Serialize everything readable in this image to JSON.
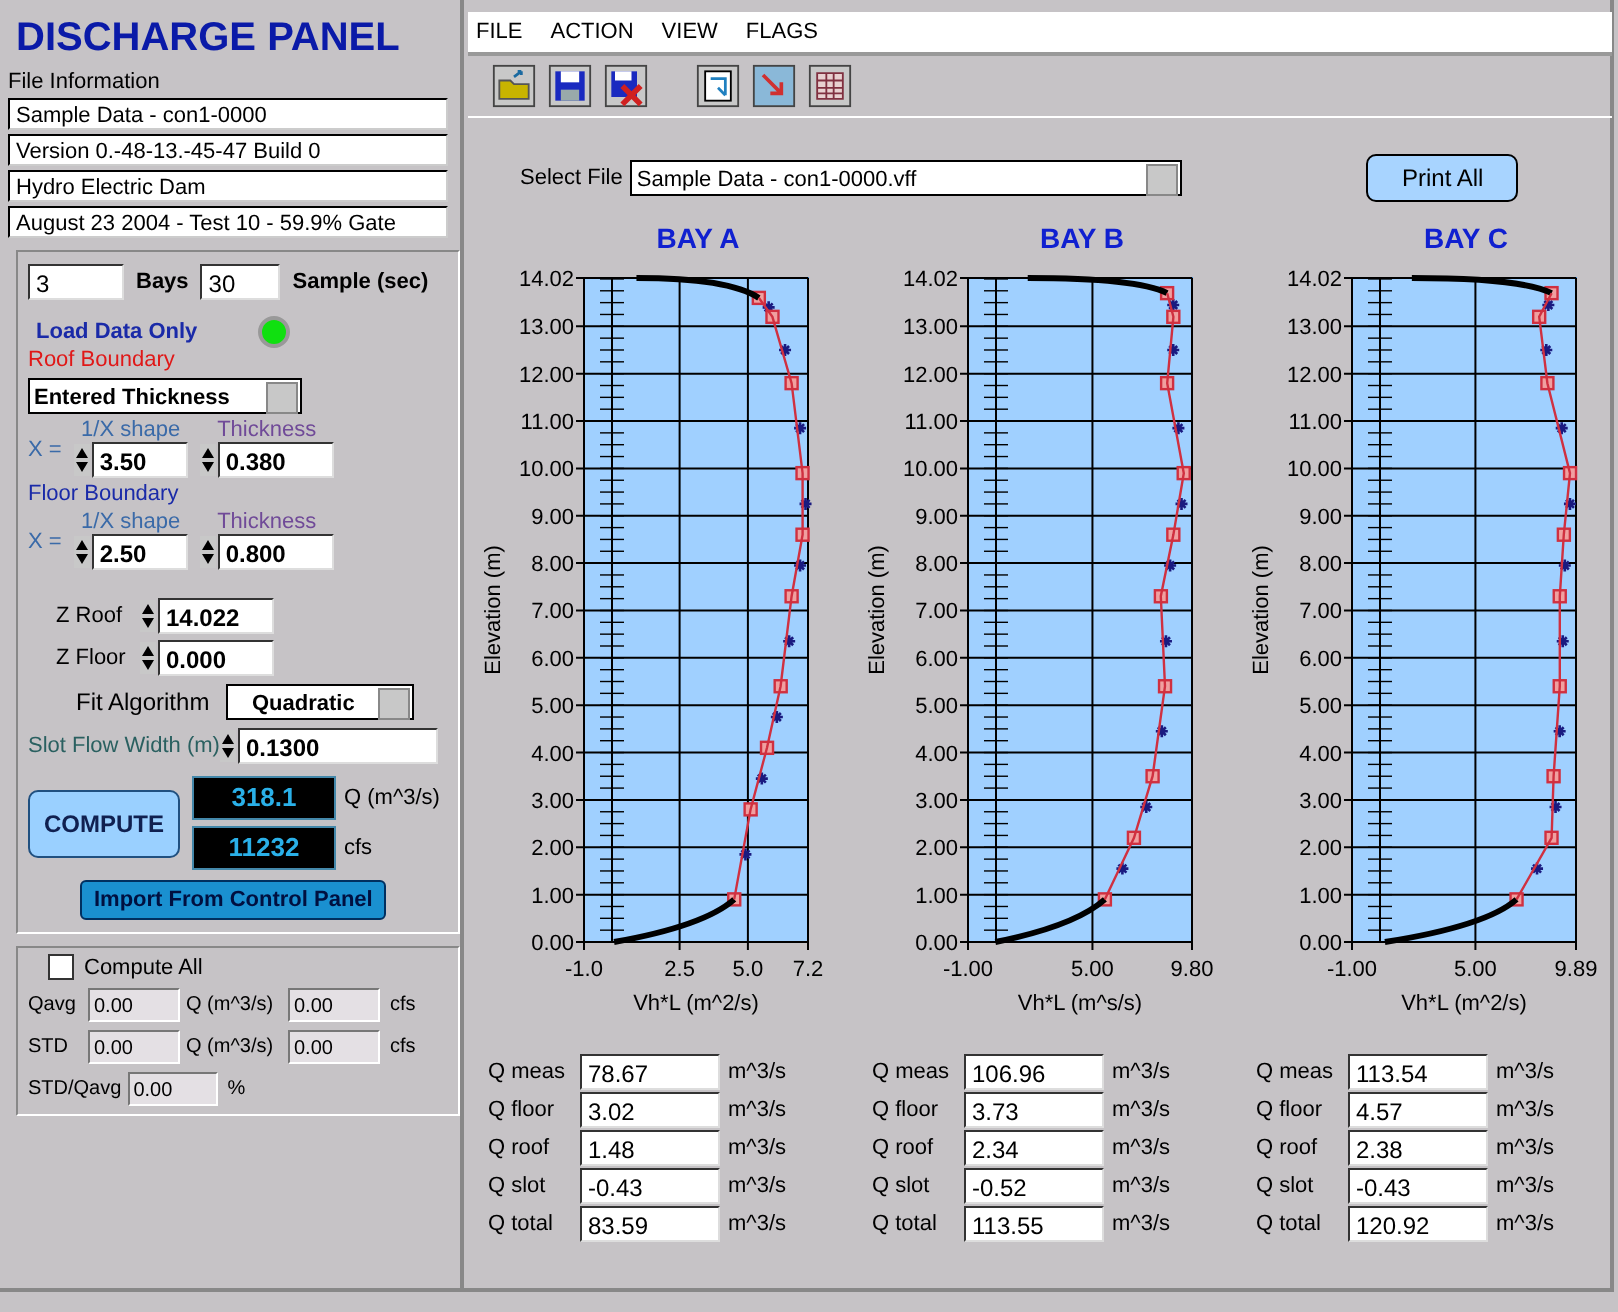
{
  "title": "DISCHARGE PANEL",
  "file_information": {
    "label": "File Information",
    "lines": [
      "Sample Data - con1-0000",
      "Version 0.-48-13.-45-47 Build 0",
      "Hydro Electric Dam",
      "August 23 2004 - Test 10 - 59.9% Gate"
    ]
  },
  "settings": {
    "bays": {
      "value": "3",
      "label": "Bays"
    },
    "sample": {
      "value": "30",
      "label": "Sample (sec)"
    },
    "load_data_only": {
      "label": "Load Data Only",
      "on": true
    },
    "roof_boundary": {
      "label": "Roof Boundary",
      "mode": "Entered Thickness",
      "x_label": "X =",
      "shape_label": "1/X shape",
      "shape": "3.50",
      "thickness_label": "Thickness",
      "thickness": "0.380"
    },
    "floor_boundary": {
      "label": "Floor Boundary",
      "x_label": "X =",
      "shape_label": "1/X shape",
      "shape": "2.50",
      "thickness_label": "Thickness",
      "thickness": "0.800"
    },
    "z_roof": {
      "label": "Z Roof",
      "value": "14.022"
    },
    "z_floor": {
      "label": "Z Floor",
      "value": "0.000"
    },
    "fit_algorithm": {
      "label": "Fit Algorithm",
      "value": "Quadratic"
    },
    "slot_flow_width": {
      "label": "Slot Flow Width (m)",
      "value": "0.1300"
    },
    "compute_button": "COMPUTE",
    "q_display": {
      "value": "318.1",
      "unit": "Q (m^3/s)"
    },
    "cfs_display": {
      "value": "11232",
      "unit": "cfs"
    },
    "import_button": "Import From Control Panel"
  },
  "summary": {
    "compute_all": {
      "label": "Compute All",
      "checked": false
    },
    "rows": [
      {
        "label": "Qavg",
        "q": "0.00",
        "q_unit": "Q (m^3/s)",
        "cfs": "0.00",
        "cfs_unit": "cfs"
      },
      {
        "label": "STD",
        "q": "0.00",
        "q_unit": "Q (m^3/s)",
        "cfs": "0.00",
        "cfs_unit": "cfs"
      }
    ],
    "ratio": {
      "label": "STD/Qavg",
      "value": "0.00",
      "unit": "%"
    }
  },
  "menu": [
    "FILE",
    "ACTION",
    "VIEW",
    "FLAGS"
  ],
  "toolbar": [
    {
      "kind": "open"
    },
    {
      "kind": "save"
    },
    {
      "kind": "delete"
    },
    {
      "kind": "copy"
    },
    {
      "kind": "export"
    },
    {
      "kind": "table"
    }
  ],
  "select_file": {
    "label": "Select File",
    "value": "Sample Data - con1-0000.vff"
  },
  "print_button": "Print All",
  "bays": [
    {
      "chart_data": {
        "type": "scatter",
        "title": "BAY A",
        "grid": true,
        "xlabel": "Vh*L (m^2/s)",
        "ylabel": "Elevation (m)",
        "x": [
          4.5,
          5.1,
          5.7,
          6.2,
          6.6,
          7.0,
          7.0,
          6.6,
          5.9,
          5.4
        ],
        "xlim": [
          -1.0,
          7.2
        ],
        "ylim": [
          0,
          14.02
        ],
        "xticks": [
          {
            "value": -1.0,
            "label": "-1.0"
          },
          {
            "value": 2.5,
            "label": "2.5"
          },
          {
            "value": 5.0,
            "label": "5.0"
          },
          {
            "value": 7.2,
            "label": "7.2"
          }
        ],
        "yticks": [
          {
            "value": 0,
            "label": "0.00"
          },
          {
            "value": 1,
            "label": "1.00"
          },
          {
            "value": 2,
            "label": "2.00"
          },
          {
            "value": 3,
            "label": "3.00"
          },
          {
            "value": 4,
            "label": "4.00"
          },
          {
            "value": 5,
            "label": "5.00"
          },
          {
            "value": 6,
            "label": "6.00"
          },
          {
            "value": 7,
            "label": "7.00"
          },
          {
            "value": 8,
            "label": "8.00"
          },
          {
            "value": 9,
            "label": "9.00"
          },
          {
            "value": 10,
            "label": "10.00"
          },
          {
            "value": 11,
            "label": "11.00"
          },
          {
            "value": 12,
            "label": "12.00"
          },
          {
            "value": 13,
            "label": "13.00"
          },
          {
            "value": 14.02,
            "label": "14.02"
          }
        ],
        "series": [
          {
            "color": "#d03040",
            "values": [
              0.9,
              2.8,
              4.1,
              5.4,
              7.3,
              8.6,
              9.9,
              11.8,
              13.2,
              13.6
            ]
          }
        ]
      },
      "results": [
        {
          "label": "Q meas",
          "value": "78.67",
          "unit": "m^3/s"
        },
        {
          "label": "Q floor",
          "value": "3.02",
          "unit": "m^3/s"
        },
        {
          "label": "Q roof",
          "value": "1.48",
          "unit": "m^3/s"
        },
        {
          "label": "Q slot",
          "value": "-0.43",
          "unit": "m^3/s"
        },
        {
          "label": "Q total",
          "value": "83.59",
          "unit": "m^3/s"
        }
      ]
    },
    {
      "chart_data": {
        "type": "scatter",
        "title": "BAY B",
        "grid": true,
        "xlabel": "Vh*L (m^s/s)",
        "ylabel": "Elevation (m)",
        "x": [
          5.6,
          7.0,
          7.9,
          8.5,
          8.3,
          8.9,
          9.4,
          8.6,
          8.9,
          8.6
        ],
        "xlim": [
          -1.0,
          9.8
        ],
        "ylim": [
          0,
          14.02
        ],
        "xticks": [
          {
            "value": -1.0,
            "label": "-1.00"
          },
          {
            "value": 5.0,
            "label": "5.00"
          },
          {
            "value": 9.8,
            "label": "9.80"
          }
        ],
        "yticks": [
          {
            "value": 0,
            "label": "0.00"
          },
          {
            "value": 1,
            "label": "1.00"
          },
          {
            "value": 2,
            "label": "2.00"
          },
          {
            "value": 3,
            "label": "3.00"
          },
          {
            "value": 4,
            "label": "4.00"
          },
          {
            "value": 5,
            "label": "5.00"
          },
          {
            "value": 6,
            "label": "6.00"
          },
          {
            "value": 7,
            "label": "7.00"
          },
          {
            "value": 8,
            "label": "8.00"
          },
          {
            "value": 9,
            "label": "9.00"
          },
          {
            "value": 10,
            "label": "10.00"
          },
          {
            "value": 11,
            "label": "11.00"
          },
          {
            "value": 12,
            "label": "12.00"
          },
          {
            "value": 13,
            "label": "13.00"
          },
          {
            "value": 14.02,
            "label": "14.02"
          }
        ],
        "series": [
          {
            "color": "#d03040",
            "values": [
              0.9,
              2.2,
              3.5,
              5.4,
              7.3,
              8.6,
              9.9,
              11.8,
              13.2,
              13.7
            ]
          }
        ]
      },
      "results": [
        {
          "label": "Q meas",
          "value": "106.96",
          "unit": "m^3/s"
        },
        {
          "label": "Q floor",
          "value": "3.73",
          "unit": "m^3/s"
        },
        {
          "label": "Q roof",
          "value": "2.34",
          "unit": "m^3/s"
        },
        {
          "label": "Q slot",
          "value": "-0.52",
          "unit": "m^3/s"
        },
        {
          "label": "Q total",
          "value": "113.55",
          "unit": "m^3/s"
        }
      ]
    },
    {
      "chart_data": {
        "type": "scatter",
        "title": "BAY C",
        "grid": true,
        "xlabel": "Vh*L (m^2/s)",
        "ylabel": "Elevation (m)",
        "x": [
          7.0,
          8.7,
          8.8,
          9.1,
          9.1,
          9.3,
          9.6,
          8.5,
          8.1,
          8.7
        ],
        "xlim": [
          -1.0,
          9.89
        ],
        "ylim": [
          0,
          14.02
        ],
        "xticks": [
          {
            "value": -1.0,
            "label": "-1.00"
          },
          {
            "value": 5.0,
            "label": "5.00"
          },
          {
            "value": 9.89,
            "label": "9.89"
          }
        ],
        "yticks": [
          {
            "value": 0,
            "label": "0.00"
          },
          {
            "value": 1,
            "label": "1.00"
          },
          {
            "value": 2,
            "label": "2.00"
          },
          {
            "value": 3,
            "label": "3.00"
          },
          {
            "value": 4,
            "label": "4.00"
          },
          {
            "value": 5,
            "label": "5.00"
          },
          {
            "value": 6,
            "label": "6.00"
          },
          {
            "value": 7,
            "label": "7.00"
          },
          {
            "value": 8,
            "label": "8.00"
          },
          {
            "value": 9,
            "label": "9.00"
          },
          {
            "value": 10,
            "label": "10.00"
          },
          {
            "value": 11,
            "label": "11.00"
          },
          {
            "value": 12,
            "label": "12.00"
          },
          {
            "value": 13,
            "label": "13.00"
          },
          {
            "value": 14.02,
            "label": "14.02"
          }
        ],
        "series": [
          {
            "color": "#d03040",
            "values": [
              0.9,
              2.2,
              3.5,
              5.4,
              7.3,
              8.6,
              9.9,
              11.8,
              13.2,
              13.7
            ]
          }
        ]
      },
      "results": [
        {
          "label": "Q meas",
          "value": "113.54",
          "unit": "m^3/s"
        },
        {
          "label": "Q floor",
          "value": "4.57",
          "unit": "m^3/s"
        },
        {
          "label": "Q roof",
          "value": "2.38",
          "unit": "m^3/s"
        },
        {
          "label": "Q slot",
          "value": "-0.43",
          "unit": "m^3/s"
        },
        {
          "label": "Q total",
          "value": "120.92",
          "unit": "m^3/s"
        }
      ]
    }
  ]
}
